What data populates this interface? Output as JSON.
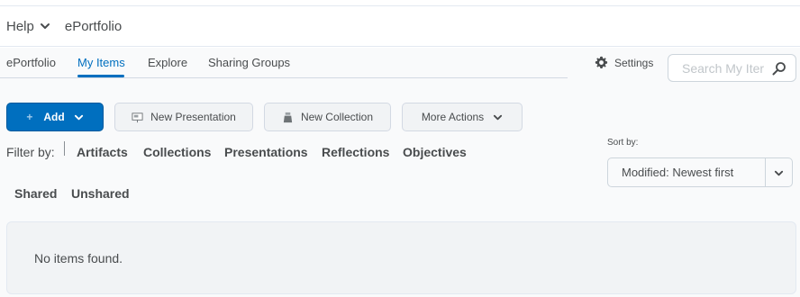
{
  "header": {
    "help_label": "Help",
    "title": "ePortfolio"
  },
  "nav": {
    "tabs": [
      {
        "label": "ePortfolio",
        "active": false
      },
      {
        "label": "My Items",
        "active": true
      },
      {
        "label": "Explore",
        "active": false
      },
      {
        "label": "Sharing Groups",
        "active": false
      }
    ],
    "settings_label": "Settings",
    "search_placeholder": "Search My Iter"
  },
  "toolbar": {
    "add_label": "Add",
    "new_presentation_label": "New Presentation",
    "new_collection_label": "New Collection",
    "more_actions_label": "More Actions"
  },
  "filter": {
    "label": "Filter by:",
    "links": [
      "Artifacts",
      "Collections",
      "Presentations",
      "Reflections",
      "Objectives",
      "Shared",
      "Unshared"
    ]
  },
  "sort": {
    "label": "Sort by:",
    "selected": "Modified: Newest first"
  },
  "results": {
    "empty_message": "No items found."
  },
  "colors": {
    "accent": "#006fbf",
    "text": "#494c4e",
    "background": "#f9fafb"
  },
  "icons": [
    "chevron-down-icon",
    "gear-icon",
    "search-icon",
    "plus-icon",
    "presentation-icon",
    "collection-icon"
  ]
}
